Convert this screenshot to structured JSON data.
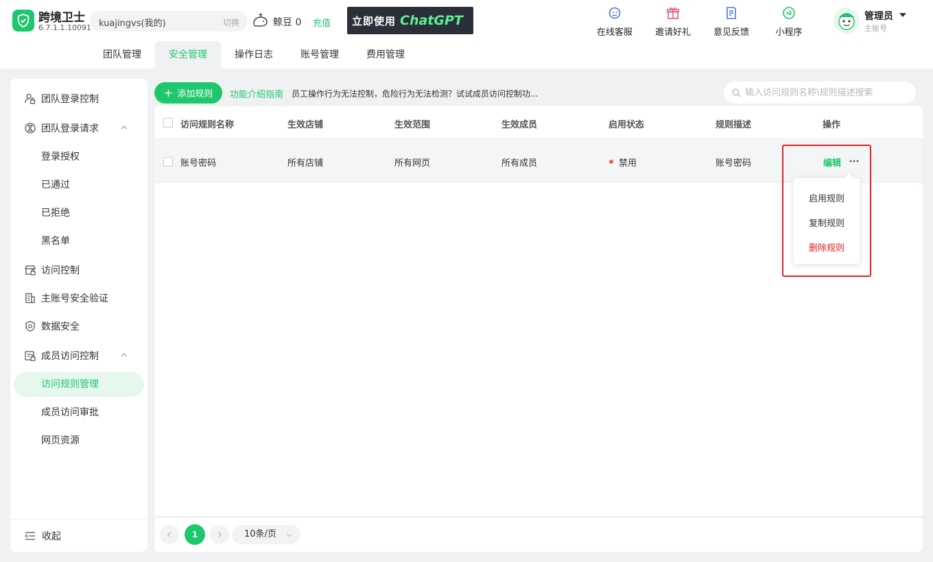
{
  "app": {
    "name": "跨境卫士",
    "version": "6.7.1.1.10091"
  },
  "account": {
    "name": "kuajingvs(我的)",
    "switch_label": "切换"
  },
  "beans": {
    "label": "鲸豆 0",
    "recharge": "充值"
  },
  "ad": {
    "text": "立即使用",
    "brand": "ChatGPT"
  },
  "top_actions": [
    {
      "label": "在线客服",
      "icon": "customer-service-icon"
    },
    {
      "label": "邀请好礼",
      "icon": "gift-icon"
    },
    {
      "label": "意见反馈",
      "icon": "feedback-icon"
    },
    {
      "label": "小程序",
      "icon": "mini-program-icon"
    }
  ],
  "user": {
    "name": "管理员",
    "role": "主账号"
  },
  "tabs": [
    {
      "label": "团队管理",
      "active": false
    },
    {
      "label": "安全管理",
      "active": true
    },
    {
      "label": "操作日志",
      "active": false
    },
    {
      "label": "账号管理",
      "active": false
    },
    {
      "label": "费用管理",
      "active": false
    }
  ],
  "sidebar": {
    "team_login_control": "团队登录控制",
    "team_login_request": "团队登录请求",
    "login_auth": "登录授权",
    "approved": "已通过",
    "rejected": "已拒绝",
    "blacklist": "黑名单",
    "access_control": "访问控制",
    "master_security": "主账号安全验证",
    "data_security": "数据安全",
    "member_access_control": "成员访问控制",
    "access_rule_mgmt": "访问规则管理",
    "member_access_approval": "成员访问审批",
    "web_resources": "网页资源",
    "collapse": "收起"
  },
  "toolbar": {
    "add_rule": "添加规则",
    "guide_title": "功能介绍指南",
    "guide_text": "员工操作行为无法控制，危险行为无法检测？试试成员访问控制功...",
    "search_placeholder": "输入访问规则名称\\规则描述搜索"
  },
  "table": {
    "headers": {
      "name": "访问规则名称",
      "shops": "生效店铺",
      "scope": "生效范围",
      "members": "生效成员",
      "status": "启用状态",
      "desc": "规则描述",
      "ops": "操作"
    },
    "rows": [
      {
        "name": "账号密码",
        "shops": "所有店铺",
        "scope": "所有网页",
        "members": "所有成员",
        "status": "禁用",
        "desc": "账号密码",
        "edit": "编辑"
      }
    ]
  },
  "dropdown": {
    "enable": "启用规则",
    "copy": "复制规则",
    "delete": "删除规则"
  },
  "pagination": {
    "current": "1",
    "page_size": "10条/页"
  },
  "colors": {
    "accent": "#1ec66c",
    "danger": "#e02020",
    "disabled_dot": "#e85a5a"
  }
}
